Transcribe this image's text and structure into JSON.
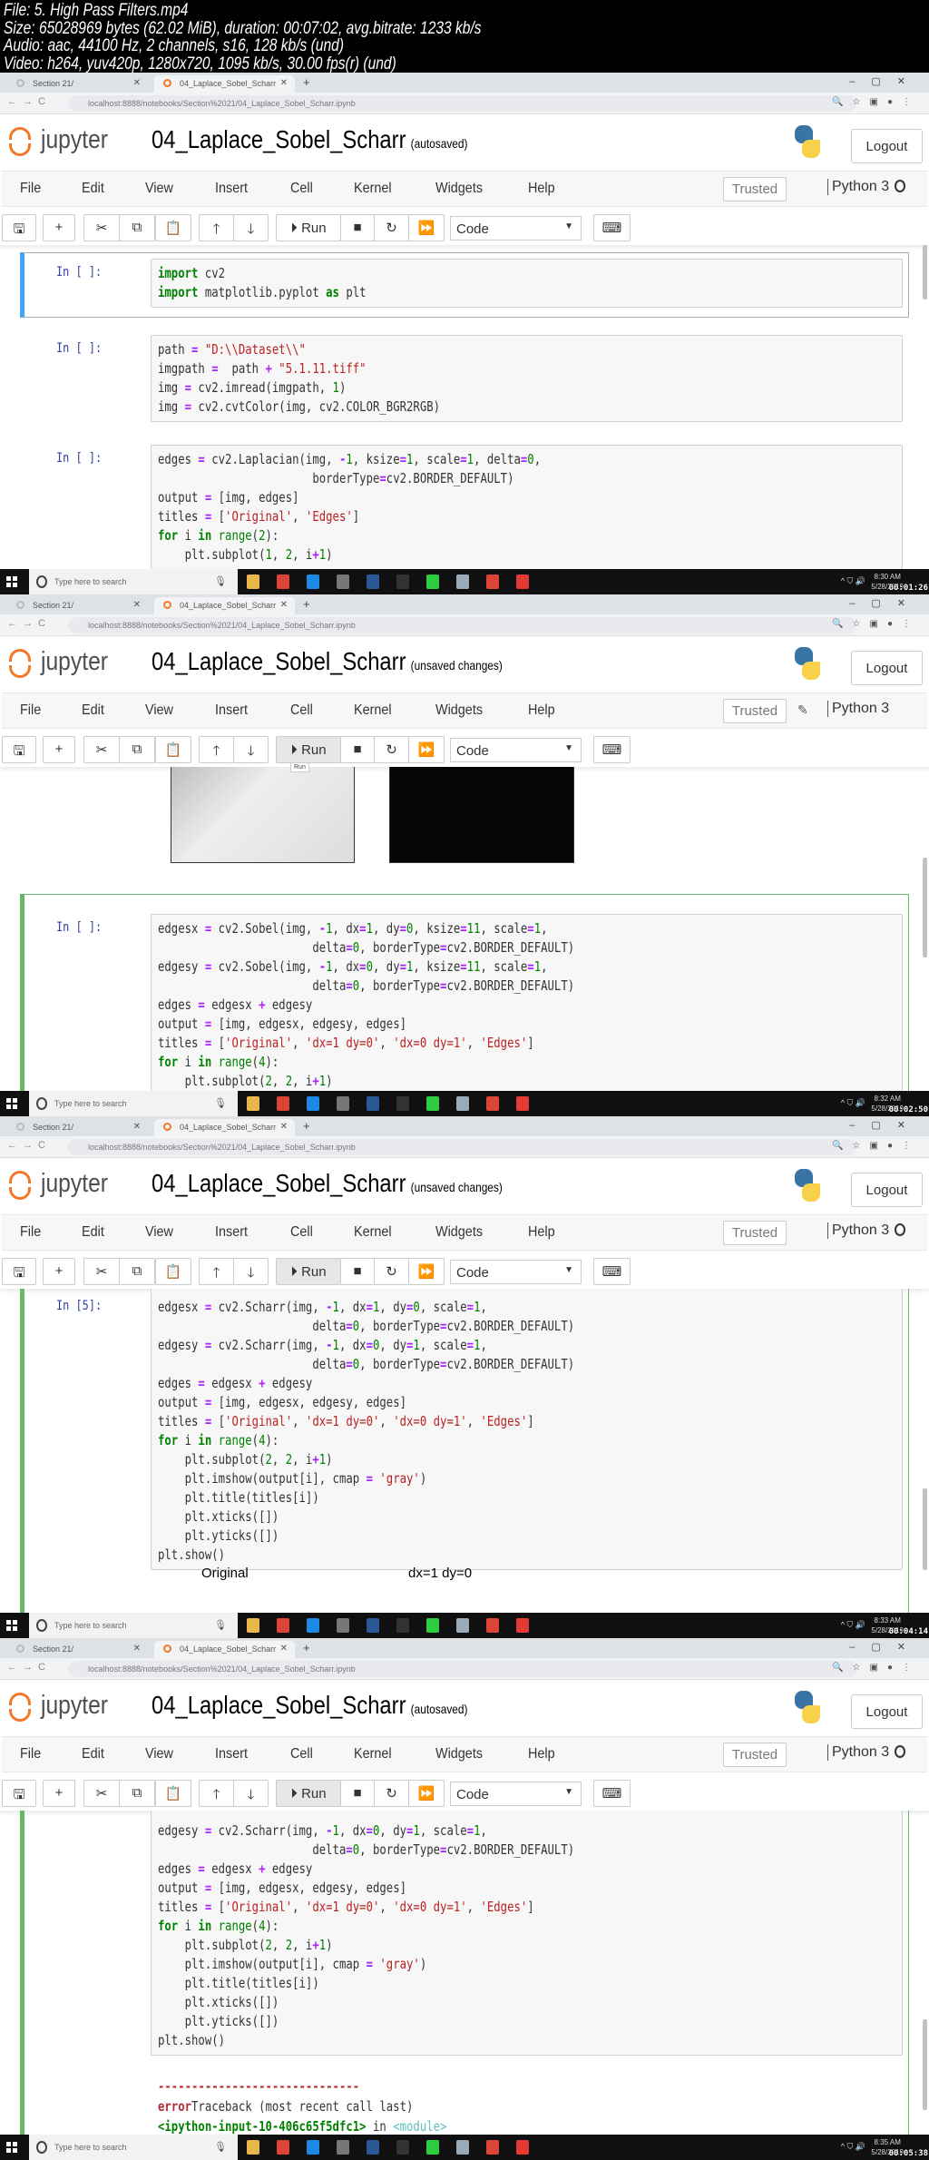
{
  "file_info": {
    "lines": [
      "File: 5. High Pass Filters.mp4",
      "Size: 65028969 bytes (62.02 MiB), duration: 00:07:02, avg.bitrate: 1233 kb/s",
      "Audio: aac, 44100 Hz, 2 channels, s16, 128 kb/s (und)",
      "Video: h264, yuv420p, 1280x720, 1095 kb/s, 30.00 fps(r) (und)"
    ]
  },
  "browser": {
    "tabs": [
      {
        "label": "Section 21/"
      },
      {
        "label": "04_Laplace_Sobel_Scharr"
      }
    ],
    "url": "localhost:8888/notebooks/Section%2021/04_Laplace_Sobel_Scharr.ipynb"
  },
  "jupyter": {
    "logo_text": "jupyter",
    "notebook_name": "04_Laplace_Sobel_Scharr",
    "logout_label": "Logout",
    "menu": [
      "File",
      "Edit",
      "View",
      "Insert",
      "Cell",
      "Kernel",
      "Widgets",
      "Help"
    ],
    "trusted_label": "Trusted",
    "kernel_name": "Python 3",
    "run_label": "Run",
    "cell_type": "Code",
    "run_tooltip": "Run",
    "accent": "#f37726"
  },
  "taskbar": {
    "search_placeholder": "Type here to search"
  },
  "frames": [
    {
      "save_status": "(autosaved)",
      "pencil": false,
      "tooltip": false,
      "clock": "8:30 AM",
      "date": "5/28/2019",
      "timestamp": "00:01:26",
      "cells": [
        {
          "prompt": "In [ ]:",
          "lines": [
            "import cv2",
            "import matplotlib.pyplot as plt"
          ]
        },
        {
          "prompt": "In [ ]:",
          "lines": [
            "path = \"D:\\\\Dataset\\\\\"",
            "imgpath =  path + \"5.1.11.tiff\"",
            "img = cv2.imread(imgpath, 1)",
            "img = cv2.cvtColor(img, cv2.COLOR_BGR2RGB)"
          ]
        },
        {
          "prompt": "In [ ]:",
          "lines": [
            "edges = cv2.Laplacian(img, -1, ksize=1, scale=1, delta=0,",
            "                       borderType=cv2.BORDER_DEFAULT)",
            "output = [img, edges]",
            "titles = ['Original', 'Edges']",
            "for i in range(2):",
            "    plt.subplot(1, 2, i+1)"
          ]
        }
      ]
    },
    {
      "save_status": "(unsaved changes)",
      "pencil": true,
      "tooltip": true,
      "clock": "8:32 AM",
      "date": "5/28/2019",
      "timestamp": "00:02:50",
      "cells": [
        {
          "prompt": "In [ ]:",
          "lines": [
            "edgesx = cv2.Sobel(img, -1, dx=1, dy=0, ksize=11, scale=1,",
            "                       delta=0, borderType=cv2.BORDER_DEFAULT)",
            "edgesy = cv2.Sobel(img, -1, dx=0, dy=1, ksize=11, scale=1,",
            "                       delta=0, borderType=cv2.BORDER_DEFAULT)",
            "edges = edgesx + edgesy",
            "output = [img, edgesx, edgesy, edges]",
            "titles = ['Original', 'dx=1 dy=0', 'dx=0 dy=1', 'Edges']",
            "for i in range(4):",
            "    plt.subplot(2, 2, i+1)"
          ]
        }
      ]
    },
    {
      "save_status": "(unsaved changes)",
      "pencil": false,
      "tooltip": false,
      "clock": "8:33 AM",
      "date": "5/28/2019",
      "timestamp": "00:04:14",
      "output_titles": [
        "Original",
        "dx=1 dy=0"
      ],
      "cells": [
        {
          "prompt": "In [5]:",
          "lines": [
            "edgesx = cv2.Scharr(img, -1, dx=1, dy=0, scale=1,",
            "                       delta=0, borderType=cv2.BORDER_DEFAULT)",
            "edgesy = cv2.Scharr(img, -1, dx=0, dy=1, scale=1,",
            "                       delta=0, borderType=cv2.BORDER_DEFAULT)",
            "edges = edgesx + edgesy",
            "output = [img, edgesx, edgesy, edges]",
            "titles = ['Original', 'dx=1 dy=0', 'dx=0 dy=1', 'Edges']",
            "for i in range(4):",
            "    plt.subplot(2, 2, i+1)",
            "    plt.imshow(output[i], cmap = 'gray')",
            "    plt.title(titles[i])",
            "    plt.xticks([])",
            "    plt.yticks([])",
            "plt.show()"
          ]
        }
      ]
    },
    {
      "save_status": "(autosaved)",
      "pencil": false,
      "tooltip": false,
      "clock": "8:35 AM",
      "date": "5/28/2019",
      "timestamp": "00:05:38",
      "cells": [
        {
          "prompt": "",
          "lines": [
            "edgesy = cv2.Scharr(img, -1, dx=0, dy=1, scale=1,",
            "                       delta=0, borderType=cv2.BORDER_DEFAULT)",
            "edges = edgesx + edgesy",
            "output = [img, edgesx, edgesy, edges]",
            "titles = ['Original', 'dx=1 dy=0', 'dx=0 dy=1', 'Edges']",
            "for i in range(4):",
            "    plt.subplot(2, 2, i+1)",
            "    plt.imshow(output[i], cmap = 'gray')",
            "    plt.title(titles[i])",
            "    plt.xticks([])",
            "    plt.yticks([])",
            "plt.show()"
          ]
        }
      ],
      "error": {
        "dashes": "------------------------------",
        "error_word": "error",
        "traceback": "Traceback (most recent call last)",
        "input_ref": "<ipython-input-10-406c65f5dfc1>",
        "in_word": " in ",
        "module": "<module>"
      }
    }
  ]
}
